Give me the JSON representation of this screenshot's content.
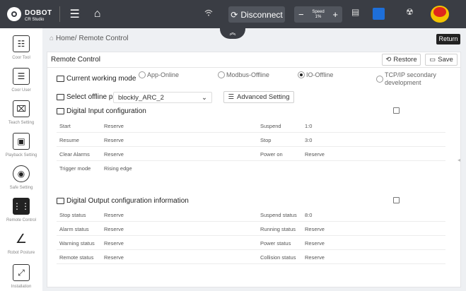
{
  "topbar": {
    "logo_main": "DOBOT",
    "logo_sub": "CR Studio",
    "menu_icon": "hamburger-icon",
    "home_icon": "home-icon",
    "wifi_icon": "wifi-icon",
    "disconnect_label": "Disconnect",
    "speed_label": "Speed",
    "speed_value": "1%",
    "speed_minus": "−",
    "speed_plus": "+",
    "accent": "#1e6fd9"
  },
  "sidebar": {
    "items": [
      {
        "label": "Coor Tool",
        "icon": "coordinate-tool-icon"
      },
      {
        "label": "Coor User",
        "icon": "coordinate-user-icon"
      },
      {
        "label": "Teach Setting",
        "icon": "teach-setting-icon"
      },
      {
        "label": "Playback Setting",
        "icon": "playback-setting-icon"
      },
      {
        "label": "Safe Setting",
        "icon": "safe-setting-icon"
      },
      {
        "label": "Remote Control",
        "icon": "remote-control-icon",
        "active": true
      },
      {
        "label": "Robot Posture",
        "icon": "robot-posture-icon"
      },
      {
        "label": "Installation",
        "icon": "installation-icon"
      }
    ]
  },
  "breadcrumb": {
    "home": "Home/",
    "current": "Remote Control"
  },
  "return_label": "Return",
  "panel": {
    "title": "Remote Control",
    "restore_label": "Restore",
    "save_label": "Save",
    "mode_label": "Current working mode",
    "modes": [
      "App-Online",
      "Modbus-Offline",
      "IO-Offline",
      "TCP/IP secondary development"
    ],
    "selected_mode": "IO-Offline",
    "offline_label": "Select offline project",
    "offline_value": "blockly_ARC_2",
    "advanced_label": "Advanced Setting",
    "input_title": "Digital Input configuration",
    "input_rows": [
      [
        "Start",
        "Reserve",
        "Suspend",
        "1:0"
      ],
      [
        "Resume",
        "Reserve",
        "Stop",
        "3:0"
      ],
      [
        "Clear Alarms",
        "Reserve",
        "Power on",
        "Reserve"
      ],
      [
        "Trigger mode",
        "Rising edge",
        "",
        ""
      ]
    ],
    "output_title": "Digital Output configuration information",
    "output_rows": [
      [
        "Stop status",
        "Reserve",
        "Suspend status",
        "8:0"
      ],
      [
        "Alarm status",
        "Reserve",
        "Running status",
        "Reserve"
      ],
      [
        "Warning status",
        "Reserve",
        "Power status",
        "Reserve"
      ],
      [
        "Remote status",
        "Reserve",
        "Collision status",
        "Reserve"
      ]
    ]
  }
}
